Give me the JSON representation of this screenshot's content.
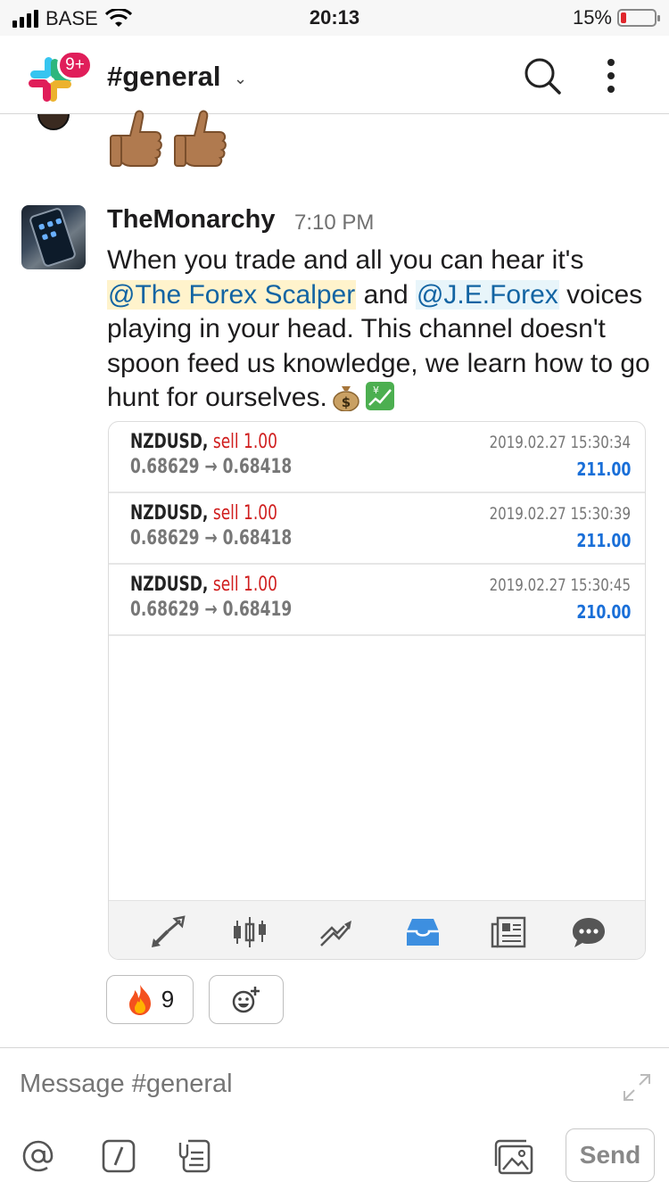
{
  "status_bar": {
    "carrier": "BASE",
    "time": "20:13",
    "battery": "15%"
  },
  "header": {
    "badge": "9+",
    "channel": "#general",
    "chevron": "⌄"
  },
  "message": {
    "author": "TheMonarchy",
    "time": "7:10 PM",
    "text_1": "When you trade and all you can hear it's ",
    "mention_1": "@The Forex Scalper",
    "text_2": " and ",
    "mention_2": "@J.E.Forex",
    "text_3": " voices playing in your head. This channel doesn't spoon feed us knowledge, we learn how to go hunt for ourselves.",
    "emojis": [
      "money-bag",
      "chart-yen"
    ]
  },
  "trades": [
    {
      "symbol": "NZDUSD,",
      "side": "sell 1.00",
      "open": "0.68629",
      "arrow": "→",
      "close": "0.68418",
      "datetime": "2019.02.27 15:30:34",
      "profit": "211.00"
    },
    {
      "symbol": "NZDUSD,",
      "side": "sell 1.00",
      "open": "0.68629",
      "arrow": "→",
      "close": "0.68418",
      "datetime": "2019.02.27 15:30:39",
      "profit": "211.00"
    },
    {
      "symbol": "NZDUSD,",
      "side": "sell 1.00",
      "open": "0.68629",
      "arrow": "→",
      "close": "0.68419",
      "datetime": "2019.02.27 15:30:45",
      "profit": "210.00"
    }
  ],
  "toolbar_icons": [
    "quotes-icon",
    "chart-icon",
    "trade-icon",
    "history-icon",
    "news-icon",
    "chat-icon"
  ],
  "reactions": {
    "fire_count": "9"
  },
  "composer": {
    "placeholder": "Message #general",
    "send_label": "Send"
  },
  "colors": {
    "sell": "#d01e1e",
    "profit": "#1a6fd8",
    "mention": "#1264a3",
    "badge": "#e01e5a"
  }
}
